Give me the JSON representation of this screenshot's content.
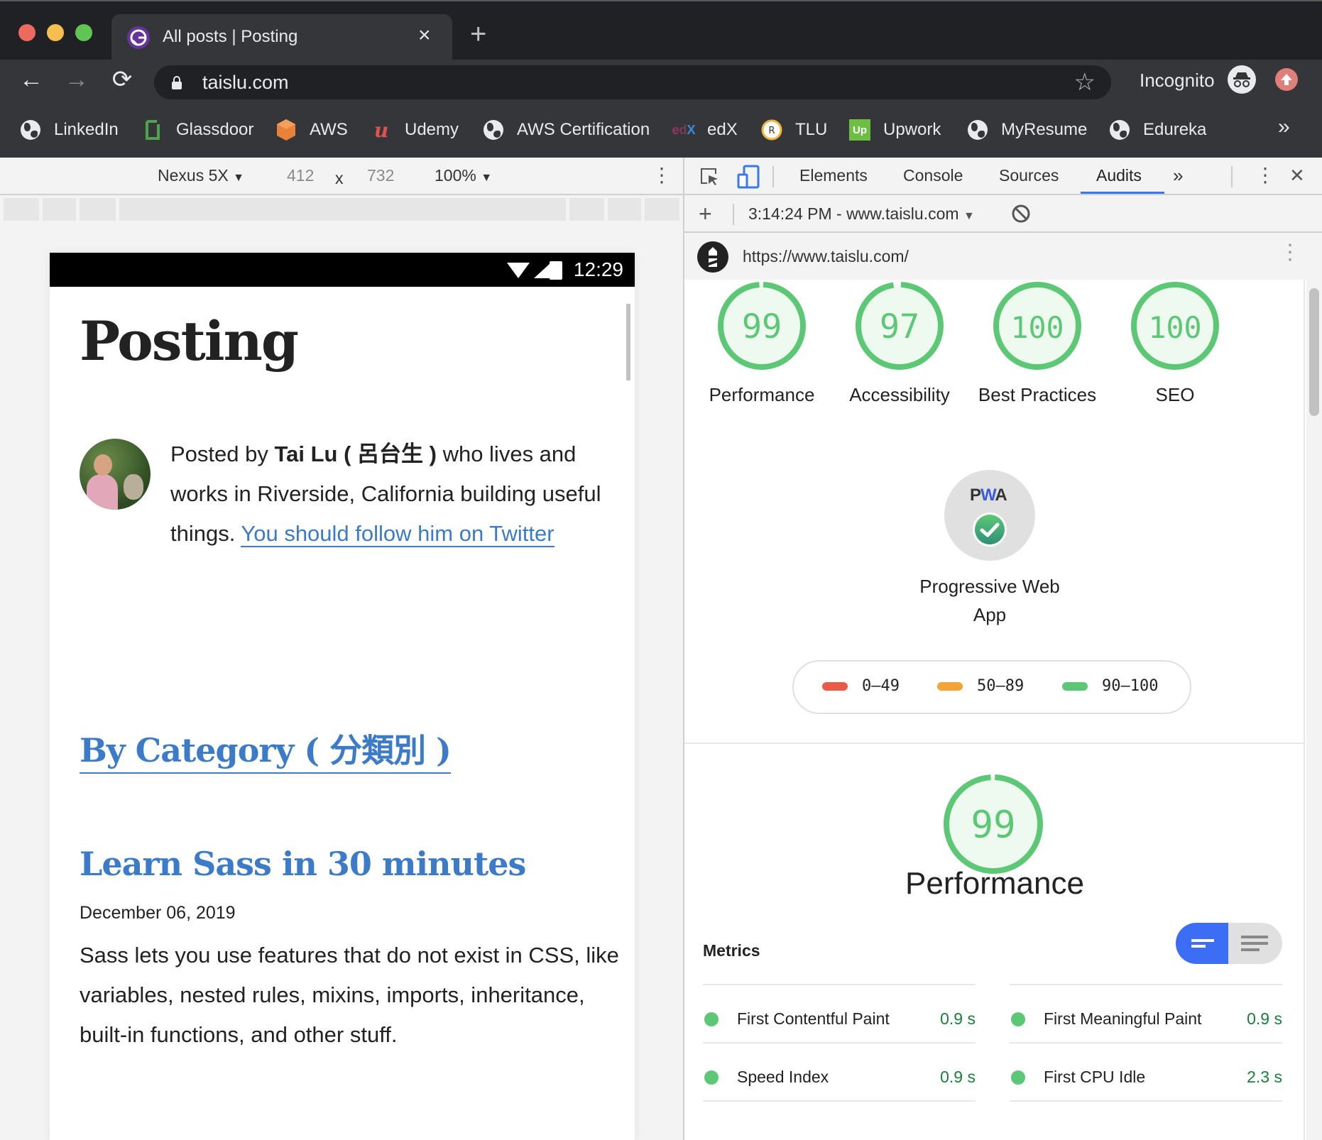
{
  "window": {
    "traffic_lights": {
      "close": "#ed6a5e",
      "minimize": "#f5bf4f",
      "zoom": "#61c554"
    }
  },
  "tab": {
    "title": "All posts | Posting",
    "favicon": "gatsby-icon",
    "close_label": "×",
    "new_tab_label": "+"
  },
  "toolbar": {
    "back_label": "←",
    "forward_label": "→",
    "reload_label": "⟳",
    "url": "taislu.com",
    "bookmark_star": "☆",
    "profile_label": "Incognito"
  },
  "bookmarks": {
    "items": [
      {
        "label": "LinkedIn",
        "icon": "globe-icon"
      },
      {
        "label": "Glassdoor",
        "icon": "glassdoor-icon"
      },
      {
        "label": "AWS",
        "icon": "aws-icon"
      },
      {
        "label": "Udemy",
        "icon": "udemy-icon"
      },
      {
        "label": "AWS Certification",
        "icon": "globe-icon"
      },
      {
        "label": "edX",
        "icon": "edx-icon"
      },
      {
        "label": "TLU",
        "icon": "tlu-icon"
      },
      {
        "label": "Upwork",
        "icon": "upwork-icon"
      },
      {
        "label": "MyResume",
        "icon": "globe-icon"
      },
      {
        "label": "Edureka",
        "icon": "globe-icon"
      }
    ],
    "overflow_label": "»"
  },
  "device_toolbar": {
    "device": "Nexus 5X",
    "width": "412",
    "times": "x",
    "height": "732",
    "zoom": "100%",
    "dropdown_arrow": "▼",
    "more_label": "⋮"
  },
  "phone": {
    "time": "12:29",
    "site_title": "Posting",
    "bio": {
      "prefix": "Posted by ",
      "author": "Tai Lu ( 呂台生 )",
      "middle": " who lives and works in Riverside, California building useful things. ",
      "link": "You should follow him on Twitter"
    },
    "category_link": "By Category ( 分類別 )",
    "post": {
      "title": "Learn Sass in 30 minutes",
      "date": "December 06, 2019",
      "excerpt": "Sass lets you use features that do not exist in CSS, like variables, nested rules, mixins, imports, inheritance, built-in functions, and other stuff."
    }
  },
  "devtools": {
    "tabs": [
      {
        "label": "Elements",
        "active": false
      },
      {
        "label": "Console",
        "active": false
      },
      {
        "label": "Sources",
        "active": false
      },
      {
        "label": "Audits",
        "active": true
      }
    ],
    "more_tabs_label": "»",
    "menu_label": "⋮",
    "close_label": "✕",
    "add_label": "+",
    "report_select": "3:14:24 PM - www.taislu.com",
    "report_dropdown": "▼",
    "audited_url": "https://www.taislu.com/",
    "url_menu_label": "⋮",
    "accent_color": "#3b78e7"
  },
  "audits": {
    "scores": [
      {
        "label": "Performance",
        "score": 99
      },
      {
        "label": "Accessibility",
        "score": 97
      },
      {
        "label": "Best Practices",
        "score": 100
      },
      {
        "label": "SEO",
        "score": 100
      }
    ],
    "pwa": {
      "badge_text": "PWA",
      "label": "Progressive Web App",
      "status": "passed"
    },
    "legend": [
      {
        "range": "0–49",
        "color": "#eb5a46"
      },
      {
        "range": "50–89",
        "color": "#f4a437"
      },
      {
        "range": "90–100",
        "color": "#5cc875"
      }
    ],
    "performance": {
      "score": 99,
      "title": "Performance",
      "metrics_label": "Metrics",
      "metrics": [
        {
          "name": "First Contentful Paint",
          "value": "0.9 s"
        },
        {
          "name": "First Meaningful Paint",
          "value": "0.9 s"
        },
        {
          "name": "Speed Index",
          "value": "0.9 s"
        },
        {
          "name": "First CPU Idle",
          "value": "2.3 s"
        }
      ]
    },
    "colors": {
      "pass": "#5cc875",
      "pass_fill": "#eef9f0",
      "pass_text": "#188038"
    }
  }
}
